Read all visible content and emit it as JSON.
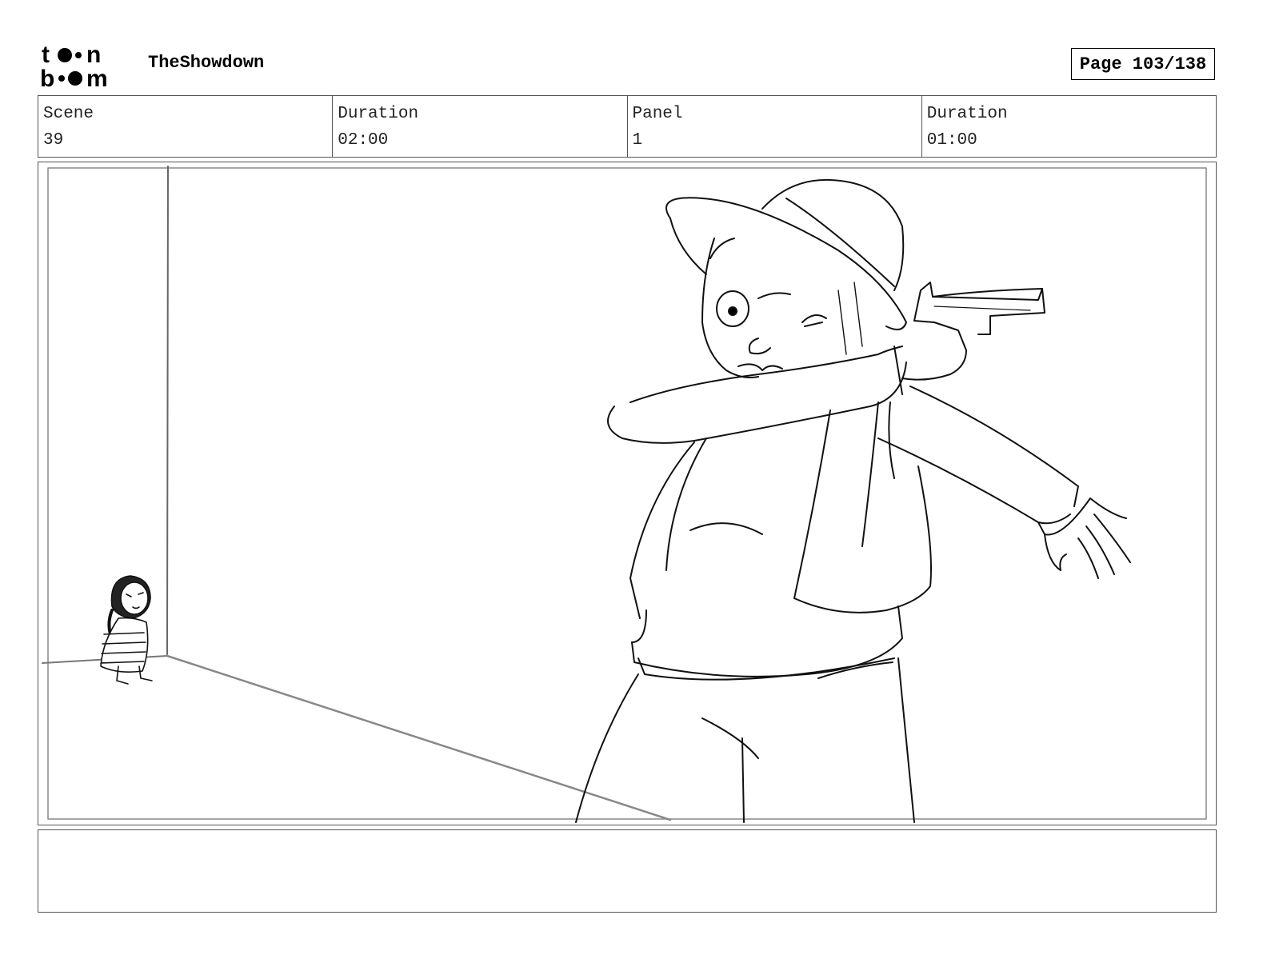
{
  "header": {
    "project_title": "TheShowdown",
    "page_label": "Page 103/138"
  },
  "info": [
    {
      "label": "Scene",
      "value": "39"
    },
    {
      "label": "Duration",
      "value": "02:00"
    },
    {
      "label": "Panel",
      "value": "1"
    },
    {
      "label": "Duration",
      "value": "01:00"
    }
  ],
  "logo": {
    "text_line1": "toon",
    "text_line2": "boom"
  },
  "notes": {
    "text": ""
  }
}
